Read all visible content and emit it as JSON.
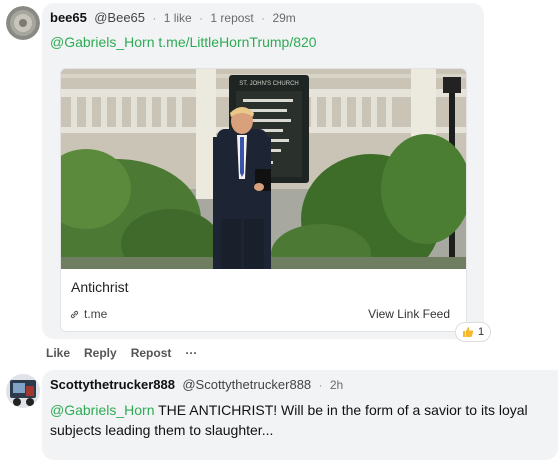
{
  "post1": {
    "username": "bee65",
    "handle": "@Bee65",
    "likes": "1 like",
    "reposts": "1 repost",
    "time": "29m",
    "mention": "@Gabriels_Horn",
    "link_text": "t.me/LittleHornTrump/820",
    "card": {
      "title": "Antichrist",
      "domain": "t.me",
      "view_link": "View Link Feed",
      "sign_text": "ST. JOHN'S CHURCH"
    },
    "reaction": {
      "icon": "thumbs-up-icon",
      "count": "1"
    },
    "actions": {
      "like": "Like",
      "reply": "Reply",
      "repost": "Repost",
      "more": "···"
    }
  },
  "post2": {
    "username": "Scottythetrucker888",
    "handle": "@Scottythetrucker888",
    "time": "2h",
    "mention": "@Gabriels_Horn",
    "text": "THE ANTICHRIST! Will be in the form of a savior to its loyal subjects leading them to slaughter..."
  },
  "colors": {
    "mention_green": "#2eaa55",
    "bubble_bg": "#f2f3f5",
    "reaction_emoji": "#f5b82e"
  }
}
